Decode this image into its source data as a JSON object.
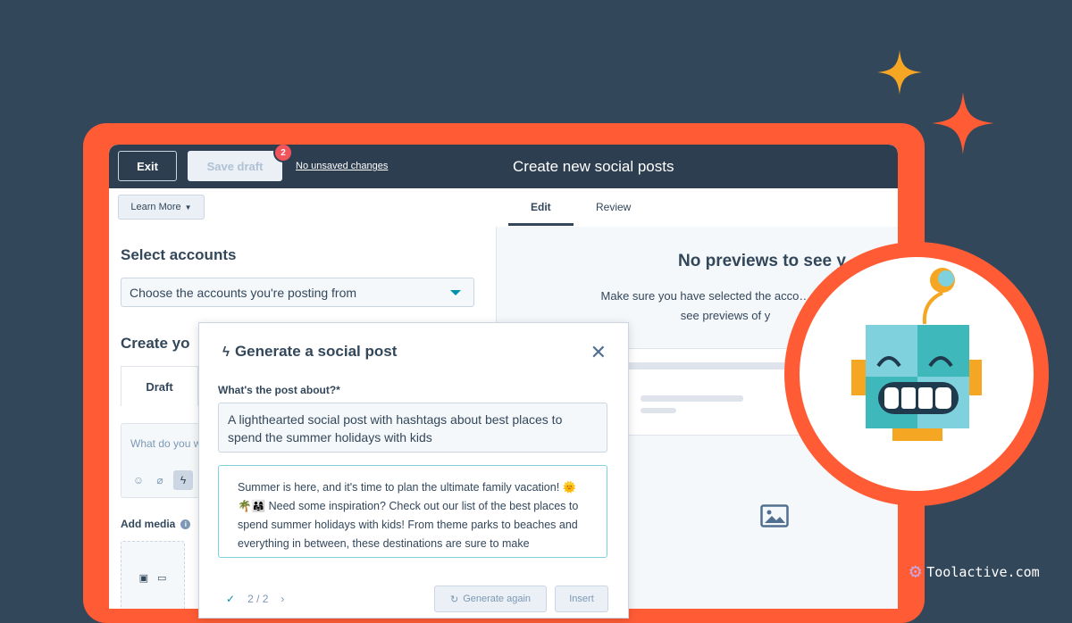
{
  "topbar": {
    "exit_label": "Exit",
    "save_draft_label": "Save draft",
    "badge_count": "2",
    "unsaved_label": "No unsaved changes",
    "title": "Create new social posts"
  },
  "subbar": {
    "learn_more_label": "Learn More",
    "tabs": [
      {
        "label": "Edit",
        "active": true
      },
      {
        "label": "Review",
        "active": false
      }
    ]
  },
  "left": {
    "select_accounts_title": "Select accounts",
    "accounts_placeholder": "Choose the accounts you're posting from",
    "create_title": "Create yo",
    "draft_tab": "Draft",
    "compose_placeholder": "What do you w",
    "add_media_label": "Add media"
  },
  "preview": {
    "title": "No previews to see y",
    "text": "Make sure you have selected the acco… from to see previews of y"
  },
  "modal": {
    "title": "Generate a social post",
    "question_label": "What's the post about?*",
    "question_value": "A lighthearted social post with hashtags about best places to spend the summer holidays with kids",
    "result_text": "Summer is here, and it's time to plan the ultimate family vacation! 🌞🌴👨‍👩‍👧 Need some inspiration? Check out our list of the best places to spend summer holidays with kids! From theme parks to beaches and everything in between, these destinations are sure to make",
    "pager": "2 / 2",
    "generate_again_label": "Generate again",
    "insert_label": "Insert"
  },
  "watermark": "Toolactive.com",
  "colors": {
    "background": "#33475b",
    "frame": "#ff5c35",
    "topbar": "#2d3e50",
    "accent_teal": "#0091ae",
    "sparkle": "#f5a623",
    "robot_teal": "#3fb8bc"
  },
  "icons": [
    "sparkle-icon",
    "close-icon",
    "lightning-icon",
    "image-icon",
    "robot-illustration",
    "emoji-icon",
    "attachment-icon",
    "info-icon"
  ]
}
